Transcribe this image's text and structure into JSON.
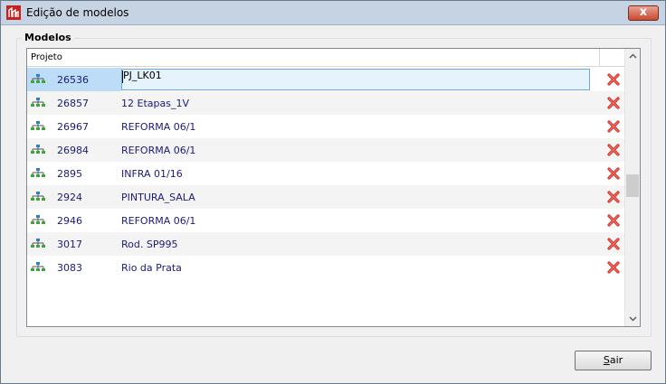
{
  "window": {
    "title": "Edição de modelos"
  },
  "group": {
    "title": "Modelos"
  },
  "grid": {
    "column_header": "Projeto",
    "rows": [
      {
        "id": "26536",
        "name": "PJ_LK01",
        "selected": true
      },
      {
        "id": "26857",
        "name": "12 Etapas_1V"
      },
      {
        "id": "26967",
        "name": "REFORMA 06/1"
      },
      {
        "id": "26984",
        "name": "REFORMA 06/1"
      },
      {
        "id": "2895",
        "name": "INFRA 01/16"
      },
      {
        "id": "2924",
        "name": "PINTURA_SALA"
      },
      {
        "id": "2946",
        "name": "REFORMA 06/1"
      },
      {
        "id": "3017",
        "name": "Rod. SP995"
      },
      {
        "id": "3083",
        "name": "Rio da Prata"
      }
    ]
  },
  "buttons": {
    "close": "x",
    "sair_first": "S",
    "sair_rest": "air"
  },
  "colors": {
    "accent": "#bcdcf7",
    "text_blue": "#1a1a7a",
    "delete_red": "#d9312b"
  }
}
